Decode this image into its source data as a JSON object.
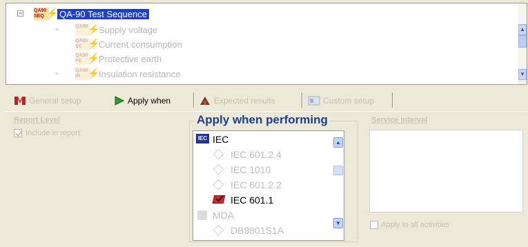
{
  "tree": {
    "root": {
      "expander": "−",
      "icon_text": "QA90 SEQ",
      "label": "QA-90 Test Sequence"
    },
    "children": [
      {
        "icon_text": "QA90",
        "label": "Supply voltage"
      },
      {
        "icon_text": "QA90 SC",
        "label": "Current consumption"
      },
      {
        "icon_text": "QA90 PE",
        "label": "Protective earth"
      },
      {
        "icon_text": "QA90 IR",
        "label": "Insulation resistance"
      }
    ],
    "scroll_up_icon": "chevron-up-icon",
    "scroll_down_icon": "chevron-down-icon"
  },
  "tabs": [
    {
      "label": "General setup",
      "icon": "general-setup-icon",
      "active": false
    },
    {
      "label": "Apply when",
      "icon": "play-arrow-icon",
      "active": true
    },
    {
      "label": "Expected results",
      "icon": "expected-results-icon",
      "active": false
    },
    {
      "label": "Custom setup",
      "icon": "custom-setup-icon",
      "active": false
    }
  ],
  "report_group": {
    "title": "Report Level",
    "include_in_report_label": "Include in report",
    "include_in_report_checked": true
  },
  "apply_group": {
    "title": "Apply when performing",
    "items": [
      {
        "label": "IEC",
        "kind": "iec-badge",
        "enabled": true
      },
      {
        "label": "IEC 601.2.4",
        "kind": "diamond",
        "enabled": false
      },
      {
        "label": "IEC 1010",
        "kind": "diamond",
        "enabled": false
      },
      {
        "label": "IEC 601.2.2",
        "kind": "diamond",
        "enabled": false
      },
      {
        "label": "IEC 601.1",
        "kind": "book-check",
        "enabled": true
      },
      {
        "label": "MDA",
        "kind": "mda",
        "enabled": false
      },
      {
        "label": "DB9801S1A",
        "kind": "diamond",
        "enabled": false
      }
    ]
  },
  "service_group": {
    "title": "Service interval",
    "apply_all_label": "Apply to all activities",
    "apply_all_checked": false
  },
  "colors": {
    "selection": "#1c41c8",
    "apply_title": "#1b3f8f",
    "faded_text": "#c3c0b3",
    "iec_badge": "#1f3593"
  }
}
